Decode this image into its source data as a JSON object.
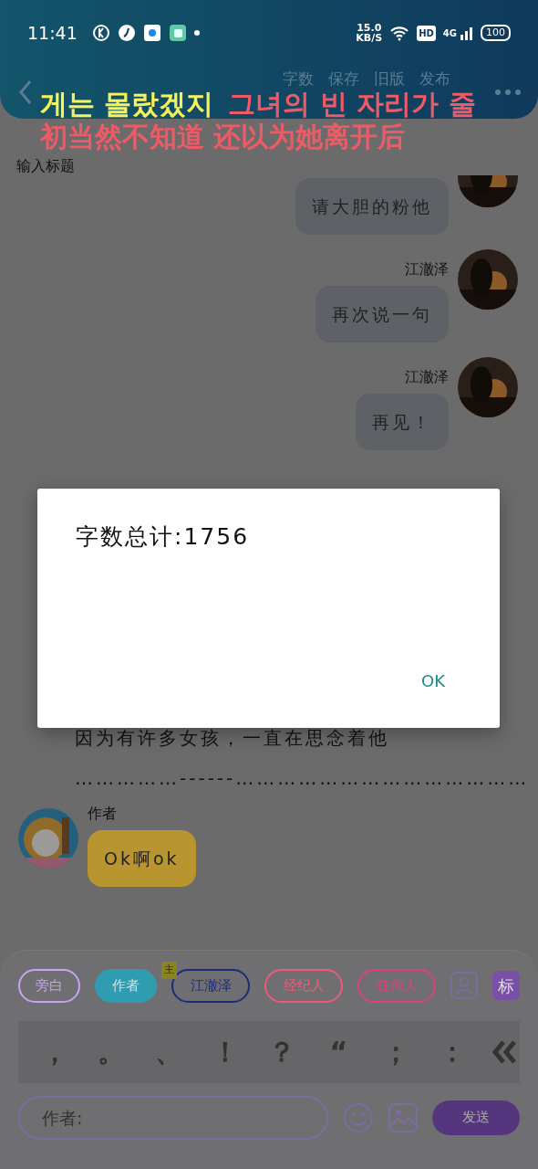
{
  "status_bar": {
    "time": "11:41",
    "speed": "15.0",
    "speed_unit": "KB/S",
    "hd": "HD",
    "network": "4G",
    "battery": "100"
  },
  "header": {
    "menu": [
      "字数",
      "保存",
      "旧版",
      "发布"
    ]
  },
  "lyrics": [
    {
      "segments": [
        {
          "text": "게는 몰랐겠지",
          "sung": true
        },
        {
          "text": "그녀의 빈 자리가 줄",
          "sung": false
        }
      ]
    },
    {
      "segments": [
        {
          "text": "初当然不知道 还以为她离开后",
          "sung": false
        }
      ]
    }
  ],
  "title_field": {
    "placeholder": "输入标题"
  },
  "messages": [
    {
      "kind": "sent",
      "text": "请大胆的粉他",
      "color": "#5e6266"
    },
    {
      "kind": "sent",
      "sender": "江澈泽",
      "text": "再次说一句",
      "color": "#5e6266"
    },
    {
      "kind": "sent",
      "sender": "江澈泽",
      "text": "再见！",
      "color": "#5e6266"
    },
    {
      "kind": "narration",
      "text": "因为有许多女孩，一直在思念着他"
    },
    {
      "kind": "narration",
      "text": "……………------……………………………………"
    },
    {
      "kind": "received",
      "sender": "作者",
      "text": "Ok啊ok",
      "color": "#b8952e"
    }
  ],
  "dialog": {
    "message": "字数总计:1756",
    "button": "OK"
  },
  "roles": [
    {
      "label": "旁白",
      "color": "#c6a4f0",
      "selected": false
    },
    {
      "label": "作者",
      "color": "#2f9cb0",
      "selected": true
    },
    {
      "label": "江澈泽",
      "color": "#1c2c78",
      "selected": false,
      "badge": "主"
    },
    {
      "label": "经纪人",
      "color": "#f05a78",
      "selected": false
    },
    {
      "label": "任何人",
      "color": "#e0407a",
      "selected": false
    }
  ],
  "tag_button": "标",
  "punctuation": [
    "，",
    "。",
    "、",
    "！",
    "？",
    "“",
    "；",
    "："
  ],
  "composer": {
    "placeholder": "作者:",
    "send": "发送"
  }
}
